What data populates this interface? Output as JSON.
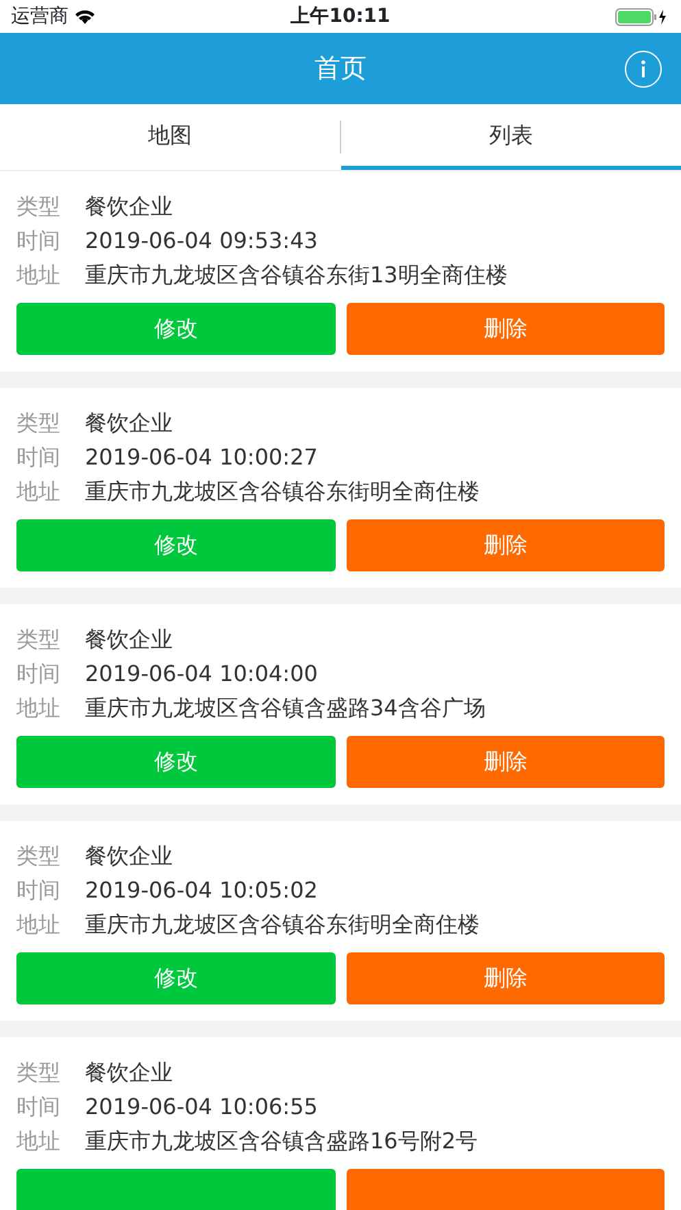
{
  "status_bar": {
    "carrier": "运营商",
    "time": "上午10:11"
  },
  "header": {
    "title": "首页"
  },
  "tabs": [
    {
      "label": "地图",
      "selected": false
    },
    {
      "label": "列表",
      "selected": true
    }
  ],
  "records": [
    {
      "fields": [
        {
          "label": "类型",
          "value": "餐饮企业"
        },
        {
          "label": "时间",
          "value": "2019-06-04 09:53:43"
        },
        {
          "label": "地址",
          "value": "重庆市九龙坡区含谷镇谷东街13明全商住楼"
        }
      ],
      "actions": [
        {
          "kind": "edit",
          "label": "修改"
        },
        {
          "kind": "delete",
          "label": "删除"
        }
      ]
    },
    {
      "fields": [
        {
          "label": "类型",
          "value": "餐饮企业"
        },
        {
          "label": "时间",
          "value": "2019-06-04 10:00:27"
        },
        {
          "label": "地址",
          "value": "重庆市九龙坡区含谷镇谷东街明全商住楼"
        }
      ],
      "actions": [
        {
          "kind": "edit",
          "label": "修改"
        },
        {
          "kind": "delete",
          "label": "删除"
        }
      ]
    },
    {
      "fields": [
        {
          "label": "类型",
          "value": "餐饮企业"
        },
        {
          "label": "时间",
          "value": "2019-06-04 10:04:00"
        },
        {
          "label": "地址",
          "value": "重庆市九龙坡区含谷镇含盛路34含谷广场"
        }
      ],
      "actions": [
        {
          "kind": "edit",
          "label": "修改"
        },
        {
          "kind": "delete",
          "label": "删除"
        }
      ]
    },
    {
      "fields": [
        {
          "label": "类型",
          "value": "餐饮企业"
        },
        {
          "label": "时间",
          "value": "2019-06-04 10:05:02"
        },
        {
          "label": "地址",
          "value": "重庆市九龙坡区含谷镇谷东街明全商住楼"
        }
      ],
      "actions": [
        {
          "kind": "edit",
          "label": "修改"
        },
        {
          "kind": "delete",
          "label": "删除"
        }
      ]
    },
    {
      "fields": [
        {
          "label": "类型",
          "value": "餐饮企业"
        },
        {
          "label": "时间",
          "value": "2019-06-04 10:06:55"
        },
        {
          "label": "地址",
          "value": "重庆市九龙坡区含谷镇含盛路16号附2号"
        }
      ],
      "actions": [
        {
          "kind": "edit"
        },
        {
          "kind": "delete"
        }
      ]
    }
  ]
}
